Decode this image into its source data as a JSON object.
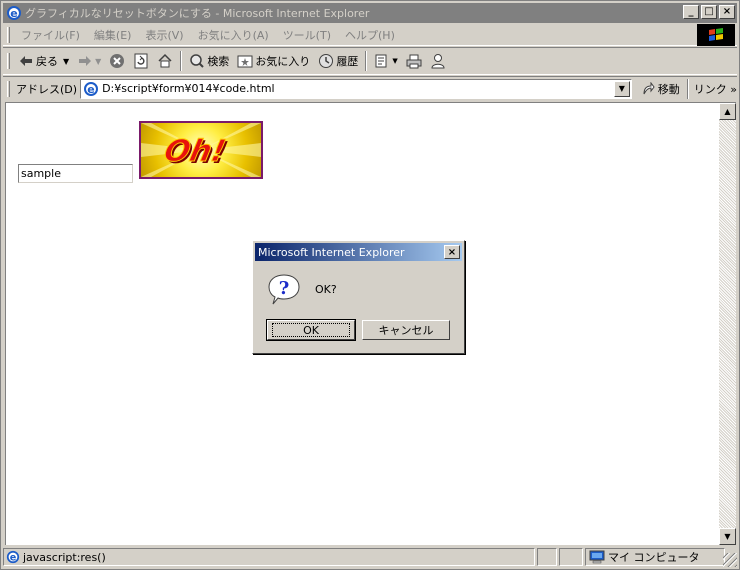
{
  "window": {
    "title": "グラフィカルなリセットボタンにする - Microsoft Internet Explorer",
    "controls": {
      "minimize": "_",
      "maximize": "□",
      "close": "×"
    }
  },
  "menu": {
    "items": [
      "ファイル(F)",
      "編集(E)",
      "表示(V)",
      "お気に入り(A)",
      "ツール(T)",
      "ヘルプ(H)"
    ]
  },
  "toolbar": {
    "back": "戻る",
    "search": "検索",
    "favorites": "お気に入り",
    "history": "履歴"
  },
  "address": {
    "label": "アドレス(D)",
    "url": "D:¥script¥form¥014¥code.html",
    "go": "移動",
    "links": "リンク »"
  },
  "page": {
    "input_value": "sample",
    "image_text": "Oh!"
  },
  "dialog": {
    "title": "Microsoft Internet Explorer",
    "message": "OK?",
    "ok": "OK",
    "cancel": "キャンセル"
  },
  "status": {
    "text": "javascript:res()",
    "zone": "マイ コンピュータ"
  }
}
